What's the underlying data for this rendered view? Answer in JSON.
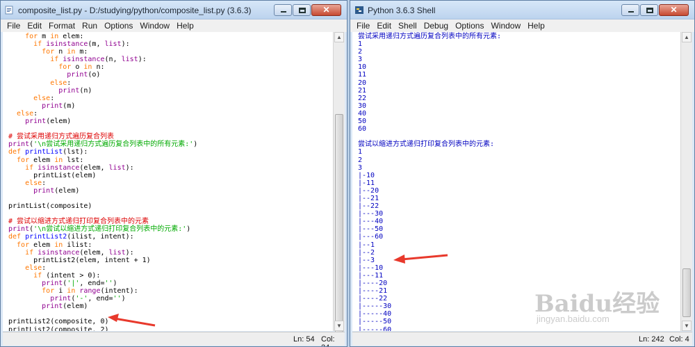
{
  "editor": {
    "title": "composite_list.py - D:/studying/python/composite_list.py (3.6.3)",
    "menu": [
      "File",
      "Edit",
      "Format",
      "Run",
      "Options",
      "Window",
      "Help"
    ],
    "status_ln": "Ln: 54",
    "status_col": "Col: 24",
    "lines": [
      [
        [
          "kw",
          "    for "
        ],
        [
          "tx",
          "m "
        ],
        [
          "kw",
          "in "
        ],
        [
          "tx",
          "elem:"
        ]
      ],
      [
        [
          "kw",
          "      if "
        ],
        [
          "bi",
          "isinstance"
        ],
        [
          "tx",
          "(m, "
        ],
        [
          "bi",
          "list"
        ],
        [
          "tx",
          "):"
        ]
      ],
      [
        [
          "kw",
          "        for "
        ],
        [
          "tx",
          "n "
        ],
        [
          "kw",
          "in "
        ],
        [
          "tx",
          "m:"
        ]
      ],
      [
        [
          "kw",
          "          if "
        ],
        [
          "bi",
          "isinstance"
        ],
        [
          "tx",
          "(n, "
        ],
        [
          "bi",
          "list"
        ],
        [
          "tx",
          "):"
        ]
      ],
      [
        [
          "kw",
          "            for "
        ],
        [
          "tx",
          "o "
        ],
        [
          "kw",
          "in "
        ],
        [
          "tx",
          "n:"
        ]
      ],
      [
        [
          "bi",
          "              print"
        ],
        [
          "tx",
          "(o)"
        ]
      ],
      [
        [
          "kw",
          "          else"
        ],
        [
          "tx",
          ":"
        ]
      ],
      [
        [
          "bi",
          "            print"
        ],
        [
          "tx",
          "(n)"
        ]
      ],
      [
        [
          "kw",
          "      else"
        ],
        [
          "tx",
          ":"
        ]
      ],
      [
        [
          "bi",
          "        print"
        ],
        [
          "tx",
          "(m)"
        ]
      ],
      [
        [
          "kw",
          "  else"
        ],
        [
          "tx",
          ":"
        ]
      ],
      [
        [
          "bi",
          "    print"
        ],
        [
          "tx",
          "(elem)"
        ]
      ],
      [
        [
          "tx",
          ""
        ]
      ],
      [
        [
          "cm",
          "# 尝试采用递归方式遍历复合列表"
        ]
      ],
      [
        [
          "bi",
          "print"
        ],
        [
          "tx",
          "("
        ],
        [
          "st",
          "'\\n尝试采用递归方式遍历复合列表中的所有元素:'"
        ],
        [
          "tx",
          ")"
        ]
      ],
      [
        [
          "kw",
          "def "
        ],
        [
          "df",
          "printList"
        ],
        [
          "tx",
          "(lst):"
        ]
      ],
      [
        [
          "kw",
          "  for "
        ],
        [
          "tx",
          "elem "
        ],
        [
          "kw",
          "in "
        ],
        [
          "tx",
          "lst:"
        ]
      ],
      [
        [
          "kw",
          "    if "
        ],
        [
          "bi",
          "isinstance"
        ],
        [
          "tx",
          "(elem, "
        ],
        [
          "bi",
          "list"
        ],
        [
          "tx",
          "):"
        ]
      ],
      [
        [
          "tx",
          "      printList(elem)"
        ]
      ],
      [
        [
          "kw",
          "    else"
        ],
        [
          "tx",
          ":"
        ]
      ],
      [
        [
          "bi",
          "      print"
        ],
        [
          "tx",
          "(elem)"
        ]
      ],
      [
        [
          "tx",
          ""
        ]
      ],
      [
        [
          "tx",
          "printList(composite)"
        ]
      ],
      [
        [
          "tx",
          ""
        ]
      ],
      [
        [
          "cm",
          "# 尝试以缩进方式递归打印复合列表中的元素"
        ]
      ],
      [
        [
          "bi",
          "print"
        ],
        [
          "tx",
          "("
        ],
        [
          "st",
          "'\\n尝试以缩进方式递归打印复合列表中的元素:'"
        ],
        [
          "tx",
          ")"
        ]
      ],
      [
        [
          "kw",
          "def "
        ],
        [
          "df",
          "printList2"
        ],
        [
          "tx",
          "(ilist, intent):"
        ]
      ],
      [
        [
          "kw",
          "  for "
        ],
        [
          "tx",
          "elem "
        ],
        [
          "kw",
          "in "
        ],
        [
          "tx",
          "ilist:"
        ]
      ],
      [
        [
          "kw",
          "    if "
        ],
        [
          "bi",
          "isinstance"
        ],
        [
          "tx",
          "(elem, "
        ],
        [
          "bi",
          "list"
        ],
        [
          "tx",
          "):"
        ]
      ],
      [
        [
          "tx",
          "      printList2(elem, intent + 1)"
        ]
      ],
      [
        [
          "kw",
          "    else"
        ],
        [
          "tx",
          ":"
        ]
      ],
      [
        [
          "kw",
          "      if "
        ],
        [
          "tx",
          "(intent > 0):"
        ]
      ],
      [
        [
          "bi",
          "        print"
        ],
        [
          "tx",
          "("
        ],
        [
          "st",
          "'|'"
        ],
        [
          "tx",
          ", end="
        ],
        [
          "st",
          "''"
        ],
        [
          "tx",
          ")"
        ]
      ],
      [
        [
          "kw",
          "        for "
        ],
        [
          "tx",
          "i "
        ],
        [
          "kw",
          "in "
        ],
        [
          "bi",
          "range"
        ],
        [
          "tx",
          "(intent):"
        ]
      ],
      [
        [
          "bi",
          "          print"
        ],
        [
          "tx",
          "("
        ],
        [
          "st",
          "'-'"
        ],
        [
          "tx",
          ", end="
        ],
        [
          "st",
          "''"
        ],
        [
          "tx",
          ")"
        ]
      ],
      [
        [
          "bi",
          "        print"
        ],
        [
          "tx",
          "(elem)"
        ]
      ],
      [
        [
          "tx",
          ""
        ]
      ],
      [
        [
          "tx",
          "printList2(composite, 0)"
        ]
      ],
      [
        [
          "tx",
          "printList2(composite, 2)"
        ]
      ]
    ]
  },
  "shell": {
    "title": "Python 3.6.3 Shell",
    "menu": [
      "File",
      "Edit",
      "Shell",
      "Debug",
      "Options",
      "Window",
      "Help"
    ],
    "status_ln": "Ln: 242",
    "status_col": "Col: 4",
    "prompt": ">>> ",
    "lines": [
      "尝试采用递归方式遍历复合列表中的所有元素:",
      "1",
      "2",
      "3",
      "10",
      "11",
      "20",
      "21",
      "22",
      "30",
      "40",
      "50",
      "60",
      "",
      "尝试以缩进方式递归打印复合列表中的元素:",
      "1",
      "2",
      "3",
      "|-10",
      "|-11",
      "|--20",
      "|--21",
      "|--22",
      "|---30",
      "|---40",
      "|---50",
      "|---60",
      "|--1",
      "|--2",
      "|--3",
      "|---10",
      "|---11",
      "|----20",
      "|----21",
      "|----22",
      "|-----30",
      "|-----40",
      "|-----50",
      "|-----60"
    ]
  },
  "watermark": {
    "brand": "Baidu经验",
    "url": "jingyan.baidu.com"
  },
  "colors": {
    "keyword": "#ff7700",
    "builtin": "#900090",
    "string": "#00aa00",
    "comment": "#dd0000",
    "def": "#0000ff",
    "output": "#0000c0",
    "arrow": "#e8392c"
  }
}
